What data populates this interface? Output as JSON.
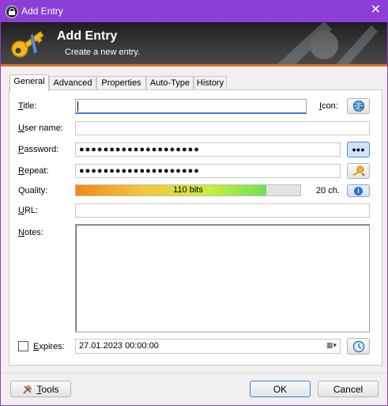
{
  "window": {
    "title": "Add Entry",
    "accent_color": "#8b3fd6",
    "close_glyph": "✕"
  },
  "banner": {
    "title": "Add Entry",
    "subtitle": "Create a new entry."
  },
  "tabs": [
    {
      "label": "General",
      "active": true
    },
    {
      "label": "Advanced"
    },
    {
      "label": "Properties"
    },
    {
      "label": "Auto-Type"
    },
    {
      "label": "History"
    }
  ],
  "form": {
    "title": {
      "label_u": "T",
      "label_rest": "itle:",
      "value": ""
    },
    "icon": {
      "label_u": "I",
      "label_rest": "con:",
      "icon_name": "globe-key-icon"
    },
    "username": {
      "label_u": "U",
      "label_rest": "ser name:",
      "value": ""
    },
    "password": {
      "label_u": "P",
      "label_rest": "assword:",
      "value": "●●●●●●●●●●●●●●●●●●●●",
      "toggle_glyph": "●●●"
    },
    "repeat": {
      "label_u": "R",
      "label_rest": "epeat:",
      "value": "●●●●●●●●●●●●●●●●●●●●",
      "generator_icon": "key-generator-icon"
    },
    "quality": {
      "label": "Quality:",
      "bits_text": "110 bits",
      "fill_fraction": 0.85,
      "length_text": "20 ch.",
      "info_glyph": "i"
    },
    "url": {
      "label_u": "U",
      "label_rest": "RL:",
      "value": ""
    },
    "notes": {
      "label_u": "N",
      "label_rest": "otes:",
      "value": ""
    },
    "expires": {
      "label_u": "E",
      "label_rest": "xpires:",
      "checked": false,
      "value": "27.01.2023 00:00:00"
    }
  },
  "buttons": {
    "tools": {
      "label_u": "T",
      "label_rest": "ools"
    },
    "ok": "OK",
    "cancel": "Cancel"
  }
}
